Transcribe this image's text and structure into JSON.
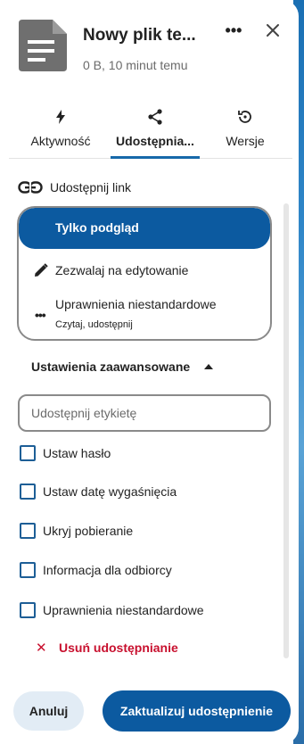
{
  "header": {
    "file_title": "Nowy plik te...",
    "file_meta": "0 B, 10 minut temu",
    "more_label": "•••"
  },
  "tabs": [
    {
      "label": "Aktywność",
      "icon": "lightning-icon",
      "active": false
    },
    {
      "label": "Udostępnia...",
      "icon": "share-icon",
      "active": true
    },
    {
      "label": "Wersje",
      "icon": "history-icon",
      "active": false
    }
  ],
  "share_link": {
    "label": "Udostępnij link",
    "icon": "link-icon"
  },
  "permissions": {
    "selected": "Tylko podgląd",
    "edit": "Zezwalaj na edytowanie",
    "custom_title": "Uprawnienia niestandardowe",
    "custom_sub": "Czytaj, udostępnij"
  },
  "advanced": {
    "title": "Ustawienia zaawansowane",
    "label_placeholder": "Udostępnij etykietę",
    "checkboxes": [
      "Ustaw hasło",
      "Ustaw datę wygaśnięcia",
      "Ukryj pobieranie",
      "Informacja dla odbiorcy",
      "Uprawnienia niestandardowe"
    ]
  },
  "unshare": {
    "x": "✕",
    "label": "Usuń udostępnianie"
  },
  "footer": {
    "cancel": "Anuluj",
    "update": "Zaktualizuj udostępnienie"
  },
  "colors": {
    "primary": "#0c5aa0",
    "danger": "#c8102e",
    "checkbox": "#1d5e96"
  }
}
